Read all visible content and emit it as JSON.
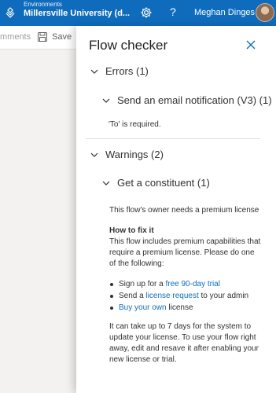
{
  "header": {
    "env_label": "Environments",
    "env_name": "Millersville University (d...",
    "help_glyph": "?",
    "user_name": "Meghan Dinges",
    "bg_color": "#0f6cbd"
  },
  "toolbar": {
    "comments_fragment": "mments",
    "save_label": "Save"
  },
  "panel": {
    "title": "Flow checker",
    "errors": {
      "label": "Errors (1)",
      "items": [
        {
          "label": "Send an email notification (V3) (1)",
          "message": "'To' is required."
        }
      ]
    },
    "warnings": {
      "label": "Warnings (2)",
      "items": [
        {
          "label": "Get a constituent (1)",
          "message": "This flow's owner needs a premium license",
          "fix_title": "How to fix it",
          "fix_intro": "This flow includes premium capabilities that require a premium license. Please do one of the following:",
          "options": {
            "opt1_prefix": "Sign up for a ",
            "opt1_link": "free 90-day trial",
            "opt2_prefix": "Send a ",
            "opt2_link": "license request",
            "opt2_suffix": " to your admin",
            "opt3_link": "Buy your own",
            "opt3_suffix": " license"
          },
          "footer": "It can take up to 7 days for the system to update your license. To use your flow right away, edit and resave it after enabling your new license or trial."
        }
      ]
    }
  },
  "colors": {
    "accent": "#0f6cbd",
    "text": "#323130",
    "divider": "#e1dfdd"
  }
}
